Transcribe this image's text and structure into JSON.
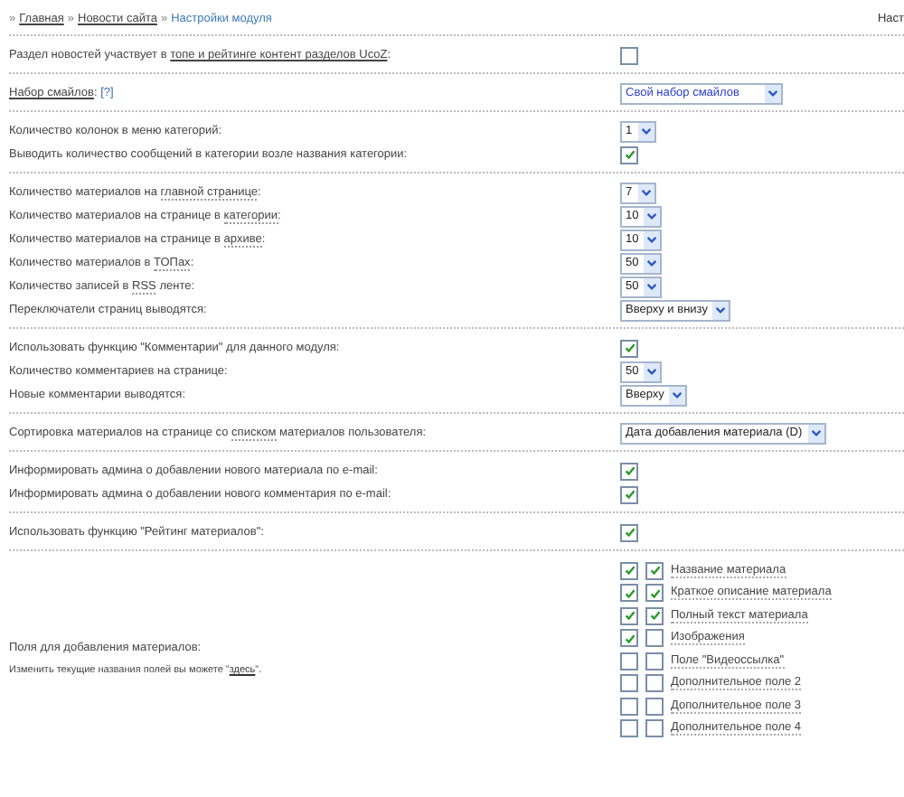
{
  "breadcrumb": [
    {
      "text": "Главная",
      "kind": "link"
    },
    {
      "text": "Новости сайта",
      "kind": "link"
    },
    {
      "text": "Настройки модуля",
      "kind": "current"
    }
  ],
  "separator": "»",
  "top_right": "Наст",
  "sections": [
    {
      "rows": [
        {
          "label": [
            {
              "text": "Раздел новостей участвует в ",
              "kind": "plain"
            },
            {
              "text": "топе и рейтинге контент разделов UcoZ",
              "kind": "link"
            },
            {
              "text": ":",
              "kind": "plain"
            }
          ],
          "control": {
            "kind": "checkbox",
            "checked": false
          }
        }
      ]
    },
    {
      "rows": [
        {
          "label": [
            {
              "text": "Набор смайлов",
              "kind": "link"
            },
            {
              "text": ": ",
              "kind": "plain"
            },
            {
              "text": "[?]",
              "kind": "help"
            }
          ],
          "control": {
            "kind": "select",
            "value": "Свой набор смайлов",
            "highlighted": true
          }
        }
      ]
    },
    {
      "rows": [
        {
          "label": [
            {
              "text": "Количество колонок в меню категорий:",
              "kind": "plain"
            }
          ],
          "control": {
            "kind": "select",
            "value": "1",
            "highlighted": false
          }
        },
        {
          "label": [
            {
              "text": "Выводить количество сообщений в категории возле названия категории:",
              "kind": "plain"
            }
          ],
          "control": {
            "kind": "checkbox",
            "checked": true
          }
        }
      ]
    },
    {
      "rows": [
        {
          "label": [
            {
              "text": "Количество материалов на ",
              "kind": "plain"
            },
            {
              "text": "главной странице",
              "kind": "hint"
            },
            {
              "text": ":",
              "kind": "plain"
            }
          ],
          "control": {
            "kind": "select",
            "value": "7",
            "highlighted": false
          }
        },
        {
          "label": [
            {
              "text": "Количество материалов на странице в ",
              "kind": "plain"
            },
            {
              "text": "категории",
              "kind": "hint"
            },
            {
              "text": ":",
              "kind": "plain"
            }
          ],
          "control": {
            "kind": "select",
            "value": "10",
            "highlighted": false
          }
        },
        {
          "label": [
            {
              "text": "Количество материалов на странице в ",
              "kind": "plain"
            },
            {
              "text": "архиве",
              "kind": "hint"
            },
            {
              "text": ":",
              "kind": "plain"
            }
          ],
          "control": {
            "kind": "select",
            "value": "10",
            "highlighted": false
          }
        },
        {
          "label": [
            {
              "text": "Количество материалов в ",
              "kind": "plain"
            },
            {
              "text": "ТОПах",
              "kind": "hint"
            },
            {
              "text": ":",
              "kind": "plain"
            }
          ],
          "control": {
            "kind": "select",
            "value": "50",
            "highlighted": false
          }
        },
        {
          "label": [
            {
              "text": "Количество записей в ",
              "kind": "plain"
            },
            {
              "text": "RSS",
              "kind": "hint"
            },
            {
              "text": " ленте:",
              "kind": "plain"
            }
          ],
          "control": {
            "kind": "select",
            "value": "50",
            "highlighted": false
          }
        },
        {
          "label": [
            {
              "text": "Переключатели страниц выводятся:",
              "kind": "plain"
            }
          ],
          "control": {
            "kind": "select",
            "value": "Вверху и внизу",
            "highlighted": false
          }
        }
      ]
    },
    {
      "rows": [
        {
          "label": [
            {
              "text": "Использовать функцию \"Комментарии\" для данного модуля:",
              "kind": "plain"
            }
          ],
          "control": {
            "kind": "checkbox",
            "checked": true
          }
        },
        {
          "label": [
            {
              "text": "Количество комментариев на странице:",
              "kind": "plain"
            }
          ],
          "control": {
            "kind": "select",
            "value": "50",
            "highlighted": false
          }
        },
        {
          "label": [
            {
              "text": "Новые комментарии выводятся:",
              "kind": "plain"
            }
          ],
          "control": {
            "kind": "select",
            "value": "Вверху",
            "highlighted": false
          }
        }
      ]
    },
    {
      "rows": [
        {
          "label": [
            {
              "text": "Сортировка материалов на странице со ",
              "kind": "plain"
            },
            {
              "text": "списком",
              "kind": "hint"
            },
            {
              "text": " материалов пользователя:",
              "kind": "plain"
            }
          ],
          "control": {
            "kind": "select",
            "value": "Дата добавления материала (D)",
            "highlighted": false
          }
        }
      ]
    },
    {
      "rows": [
        {
          "label": [
            {
              "text": "Информировать админа о добавлении нового материала по e-mail:",
              "kind": "plain"
            }
          ],
          "control": {
            "kind": "checkbox",
            "checked": true
          }
        },
        {
          "label": [
            {
              "text": "Информировать админа о добавлении нового комментария по e-mail:",
              "kind": "plain"
            }
          ],
          "control": {
            "kind": "checkbox",
            "checked": true
          }
        }
      ]
    },
    {
      "rows": [
        {
          "label": [
            {
              "text": "Использовать функцию \"Рейтинг материалов\":",
              "kind": "plain"
            }
          ],
          "control": {
            "kind": "checkbox",
            "checked": true
          }
        }
      ]
    }
  ],
  "fields_section": {
    "title": "Поля для добавления материалов:",
    "note": [
      {
        "text": "Изменить текущие названия полей вы можете ",
        "kind": "plain"
      },
      {
        "text": "\"",
        "kind": "plain"
      },
      {
        "text": "здесь",
        "kind": "link"
      },
      {
        "text": "\".",
        "kind": "plain"
      }
    ],
    "fields": [
      {
        "label": "Название материала",
        "enabled": true,
        "required": true
      },
      {
        "label": "Краткое описание материала",
        "enabled": true,
        "required": true
      },
      {
        "label": "Полный текст материала",
        "enabled": true,
        "required": true
      },
      {
        "label": "Изображения",
        "enabled": true,
        "required": false
      },
      {
        "label": "Поле \"Видеоссылка\"",
        "enabled": false,
        "required": false
      },
      {
        "label": "Дополнительное поле 2",
        "enabled": false,
        "required": false
      },
      {
        "label": "Дополнительное поле 3",
        "enabled": false,
        "required": false
      },
      {
        "label": "Дополнительное поле 4",
        "enabled": false,
        "required": false
      }
    ]
  }
}
